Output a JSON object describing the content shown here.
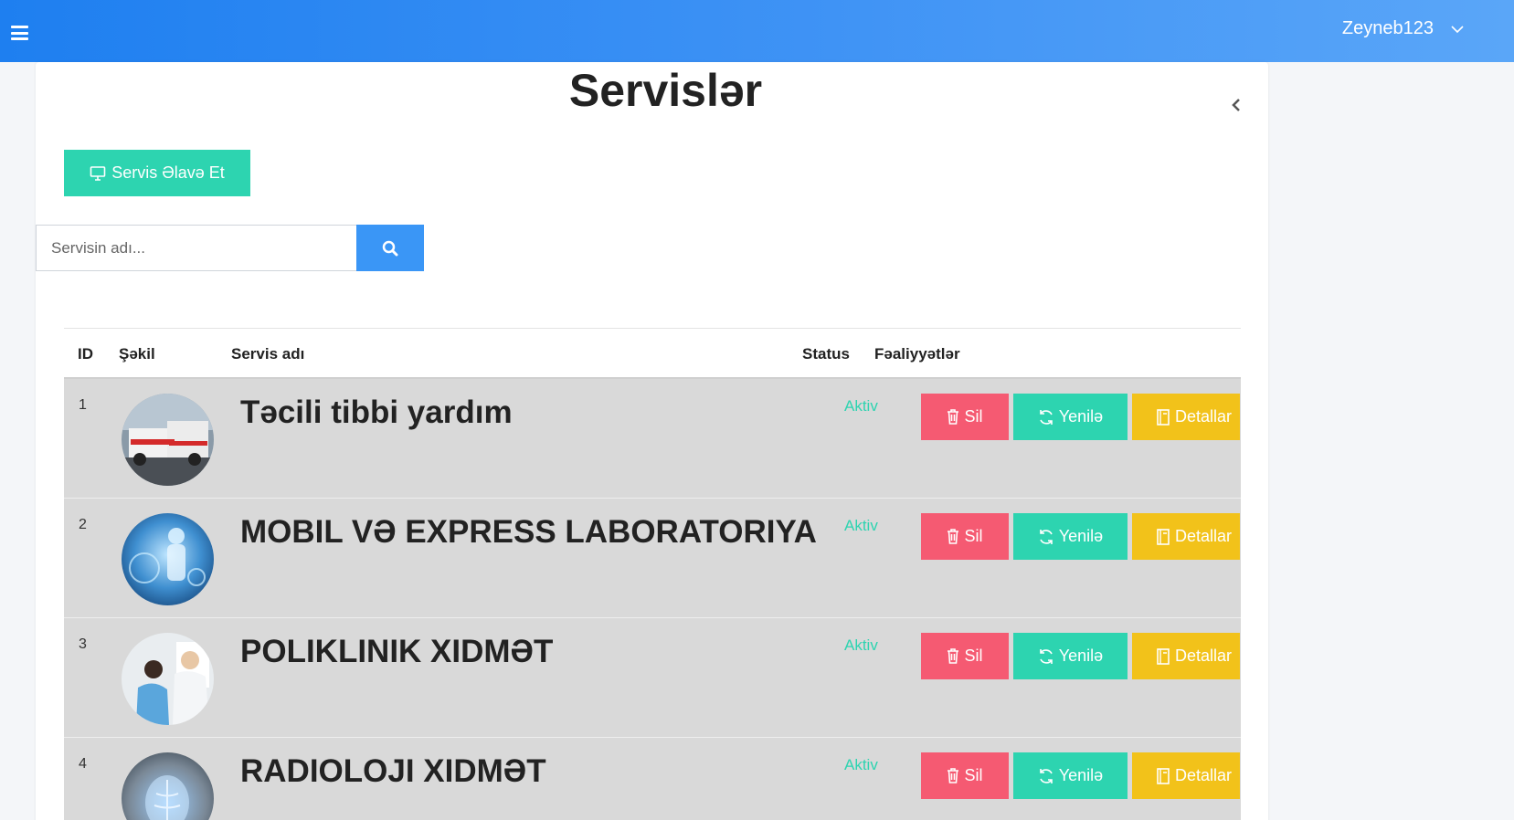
{
  "header": {
    "user_name": "Zeyneb123"
  },
  "page": {
    "title": "Servislər"
  },
  "add_button": {
    "label": "Servis Əlavə Et"
  },
  "search": {
    "placeholder": "Servisin adı..."
  },
  "table": {
    "columns": [
      "ID",
      "Şəkil",
      "Servis adı",
      "Status",
      "Fəaliyyətlər"
    ],
    "rows": [
      {
        "id": "1",
        "name": "Təcili tibbi yardım",
        "status": "Aktiv",
        "image": "ambulance-photo"
      },
      {
        "id": "2",
        "name": "MOBIL VƏ EXPRESS LABORATORIYA",
        "status": "Aktiv",
        "image": "digital-health-photo"
      },
      {
        "id": "3",
        "name": "POLIKLINIK XIDMƏT",
        "status": "Aktiv",
        "image": "clinic-photo"
      },
      {
        "id": "4",
        "name": "RADIOLOJI XIDMƏT",
        "status": "Aktiv",
        "image": "radiology-photo"
      }
    ],
    "actions": {
      "delete": "Sil",
      "update": "Yenilə",
      "details": "Detallar"
    }
  },
  "colors": {
    "header_start": "#1e7ff0",
    "header_end": "#5aa6f8",
    "teal": "#2dd4b0",
    "red": "#f55a72",
    "yellow": "#f2c21a",
    "blue": "#3a96f6",
    "row_bg": "#d9d9d9"
  },
  "icons": [
    "menu-icon",
    "chevron-down-icon",
    "chevron-left-icon",
    "monitor-icon",
    "search-icon",
    "trash-icon",
    "refresh-icon",
    "book-icon"
  ]
}
